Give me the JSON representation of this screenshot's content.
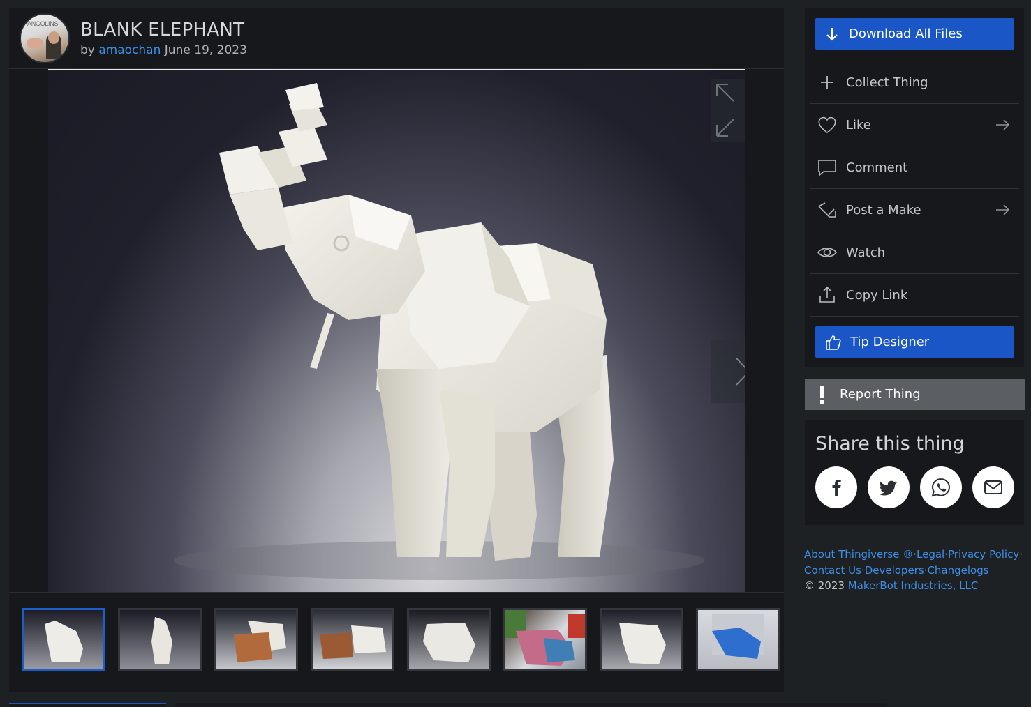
{
  "thing": {
    "title": "BLANK ELEPHANT",
    "by_prefix": "by",
    "author": "amaochan",
    "date": "June 19, 2023",
    "avatar_text": "PANGOLINS"
  },
  "thumbnails": [
    {
      "label": "thumbnail-1",
      "active": true
    },
    {
      "label": "thumbnail-2",
      "active": false
    },
    {
      "label": "thumbnail-3",
      "active": false
    },
    {
      "label": "thumbnail-4",
      "active": false
    },
    {
      "label": "thumbnail-5",
      "active": false
    },
    {
      "label": "thumbnail-6",
      "active": false
    },
    {
      "label": "thumbnail-7",
      "active": false
    },
    {
      "label": "thumbnail-8",
      "active": false
    }
  ],
  "actions": {
    "download": "Download All Files",
    "collect": "Collect Thing",
    "like": "Like",
    "comment": "Comment",
    "post_make": "Post a Make",
    "watch": "Watch",
    "copy_link": "Copy Link",
    "tip": "Tip Designer",
    "report": "Report Thing"
  },
  "share": {
    "title": "Share this thing",
    "targets": [
      "facebook",
      "twitter",
      "whatsapp",
      "email"
    ]
  },
  "footer": {
    "about": "About Thingiverse ®",
    "legal": "Legal",
    "privacy": "Privacy Policy",
    "contact": "Contact Us",
    "developers": "Developers",
    "changelogs": "Changelogs",
    "sep": "·",
    "copyright_prefix": "©  2023",
    "company": "MakerBot Industries, LLC"
  },
  "colors": {
    "primary_button": "#1a56c6",
    "link": "#3d8fe8",
    "panel": "#16181b",
    "background": "#1e2124",
    "report_button": "#5b5f64"
  }
}
